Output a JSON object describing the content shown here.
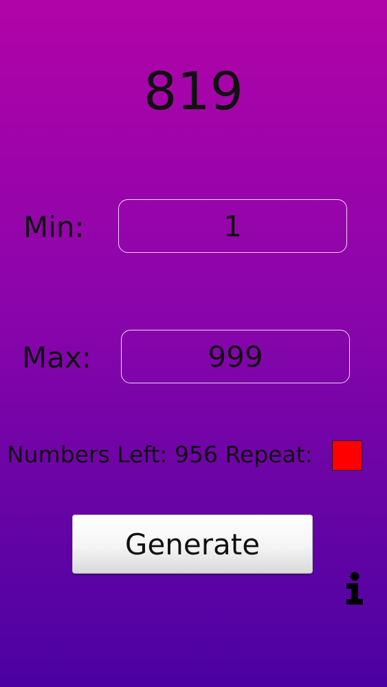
{
  "result": "819",
  "min": {
    "label": "Min:",
    "value": "1"
  },
  "max": {
    "label": "Max:",
    "value": "999"
  },
  "status": {
    "numbers_left_label": "Numbers Left:",
    "numbers_left_value": "956",
    "repeat_label": "Repeat:",
    "repeat_color": "#ff0000"
  },
  "generate_label": "Generate",
  "info_icon": "info-icon",
  "colors": {
    "gradient_top": "#b004a8",
    "gradient_bottom": "#4b02a2"
  }
}
